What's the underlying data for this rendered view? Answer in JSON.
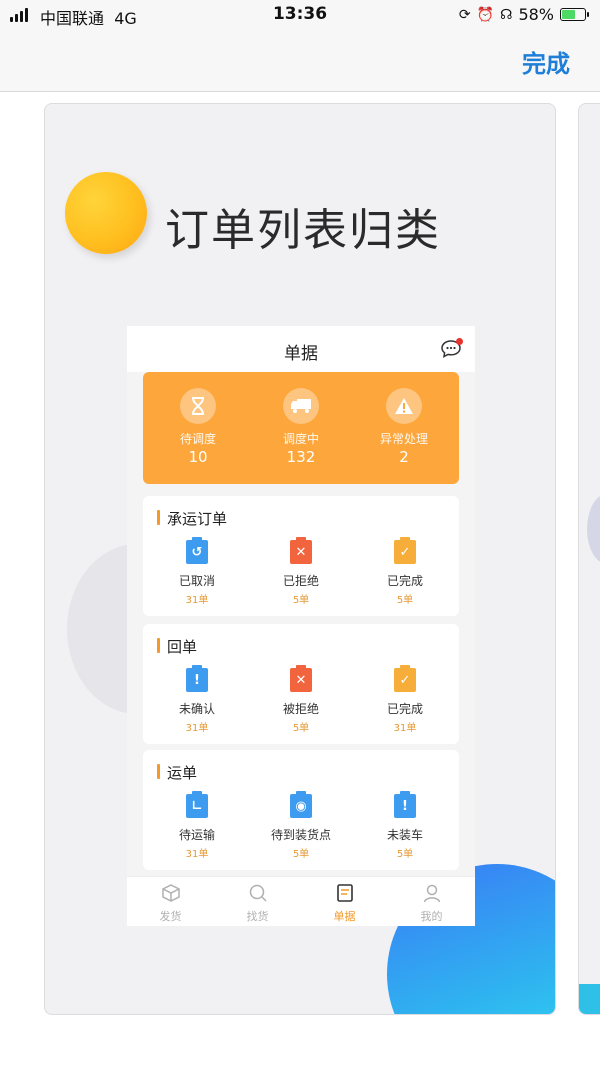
{
  "status_bar": {
    "carrier": "中国联通",
    "network": "4G",
    "time": "13:36",
    "battery": "58%",
    "battery_level": 0.58
  },
  "nav": {
    "done_label": "完成",
    "accent": "#1e7ed8"
  },
  "hero": {
    "title": "订单列表归类"
  },
  "mock_app": {
    "title": "单据",
    "summary": [
      {
        "label": "待调度",
        "count": "10",
        "icon": "hourglass-icon"
      },
      {
        "label": "调度中",
        "count": "132",
        "icon": "truck-icon"
      },
      {
        "label": "异常处理",
        "count": "2",
        "icon": "warning-icon"
      }
    ],
    "sections": [
      {
        "title": "承运订单",
        "items": [
          {
            "label": "已取消",
            "count": "31单",
            "icon": "undo-icon",
            "color": "#3d9bf0"
          },
          {
            "label": "已拒绝",
            "count": "5单",
            "icon": "cross-icon",
            "color": "#f2643d"
          },
          {
            "label": "已完成",
            "count": "5单",
            "icon": "check-icon",
            "color": "#f6ad3a"
          }
        ]
      },
      {
        "title": "回单",
        "items": [
          {
            "label": "未确认",
            "count": "31单",
            "icon": "exclamation-icon",
            "color": "#3d9bf0"
          },
          {
            "label": "被拒绝",
            "count": "5单",
            "icon": "cross-icon",
            "color": "#f2643d"
          },
          {
            "label": "已完成",
            "count": "31单",
            "icon": "check-icon",
            "color": "#f6ad3a"
          }
        ]
      },
      {
        "title": "运单",
        "items": [
          {
            "label": "待运输",
            "count": "31单",
            "icon": "clock-icon",
            "color": "#3d9bf0"
          },
          {
            "label": "待到装货点",
            "count": "5单",
            "icon": "location-icon",
            "color": "#3d9bf0"
          },
          {
            "label": "未装车",
            "count": "5单",
            "icon": "exclamation-icon",
            "color": "#3d9bf0"
          }
        ]
      }
    ],
    "tabs": [
      {
        "label": "发货",
        "icon": "box-icon"
      },
      {
        "label": "找货",
        "icon": "search-icon"
      },
      {
        "label": "单据",
        "icon": "document-icon",
        "active": true
      },
      {
        "label": "我的",
        "icon": "user-icon"
      }
    ]
  }
}
